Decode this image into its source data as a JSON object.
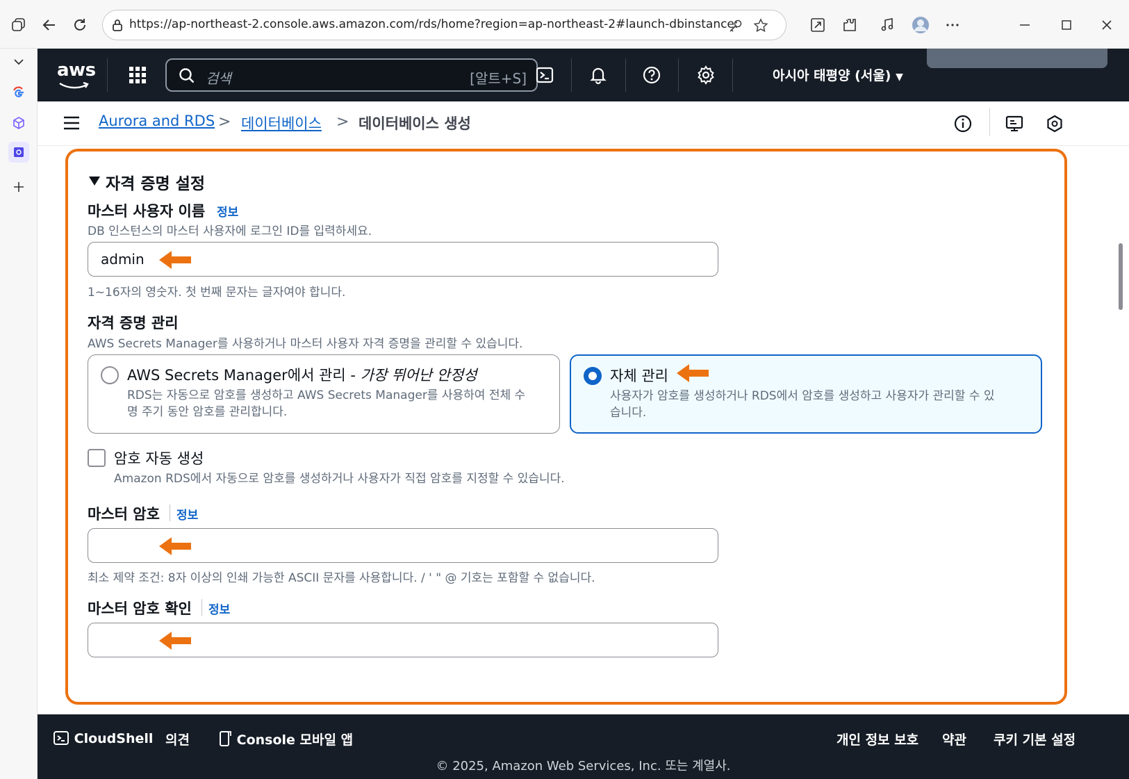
{
  "browser": {
    "url": "https://ap-northeast-2.console.aws.amazon.com/rds/home?region=ap-northeast-2#launch-dbinstance:"
  },
  "aws_nav": {
    "logo": "aws",
    "search_placeholder": "검색",
    "search_shortcut": "[알트+S]",
    "region": "아시아 태평양 (서울)"
  },
  "breadcrumb": {
    "items": [
      "Aurora and RDS",
      "데이터베이스"
    ],
    "current": "데이터베이스 생성",
    "separator": ">"
  },
  "section": {
    "title": "자격 증명 설정"
  },
  "master_username": {
    "label": "마스터 사용자 이름",
    "info": "정보",
    "description": "DB 인스턴스의 마스터 사용자에 로그인 ID를 입력하세요.",
    "value": "admin",
    "hint": "1~16자의 영숫자. 첫 번째 문자는 글자여야 합니다."
  },
  "credential_management": {
    "label": "자격 증명 관리",
    "description": "AWS Secrets Manager를 사용하거나 마스터 사용자 자격 증명을 관리할 수 있습니다.",
    "options": [
      {
        "title": "AWS Secrets Manager에서 관리 - ",
        "title_italic": "가장 뛰어난 안정성",
        "description_line1": "RDS는 자동으로 암호를 생성하고 AWS Secrets Manager를 사용하여 전체 수",
        "description_line2": "명 주기 동안 암호를 관리합니다.",
        "selected": false
      },
      {
        "title": "자체 관리",
        "description_line1": "사용자가 암호를 생성하거나 RDS에서 암호를 생성하고 사용자가 관리할 수 있",
        "description_line2": "습니다.",
        "selected": true
      }
    ]
  },
  "auto_password": {
    "label": "암호 자동 생성",
    "description": "Amazon RDS에서 자동으로 암호를 생성하거나 사용자가 직접 암호를 지정할 수 있습니다.",
    "checked": false
  },
  "master_password": {
    "label": "마스터 암호",
    "info": "정보",
    "value": "",
    "hint": "최소 제약 조건: 8자 이상의 인쇄 가능한 ASCII 문자를 사용합니다. / ' \" @ 기호는 포함할 수 없습니다."
  },
  "confirm_password": {
    "label": "마스터 암호 확인",
    "info": "정보",
    "value": ""
  },
  "footer": {
    "cloudshell": "CloudShell",
    "feedback": "의견",
    "mobile_app": "Console 모바일 앱",
    "privacy": "개인 정보 보호",
    "terms": "약관",
    "cookies": "쿠키 기본 설정",
    "copyright": "© 2025, Amazon Web Services, Inc. 또는 계열사."
  },
  "colors": {
    "aws_nav_bg": "#161d26",
    "link": "#0f64c8",
    "highlight": "#ec7211",
    "selected_card_bg": "#f0fbff"
  }
}
